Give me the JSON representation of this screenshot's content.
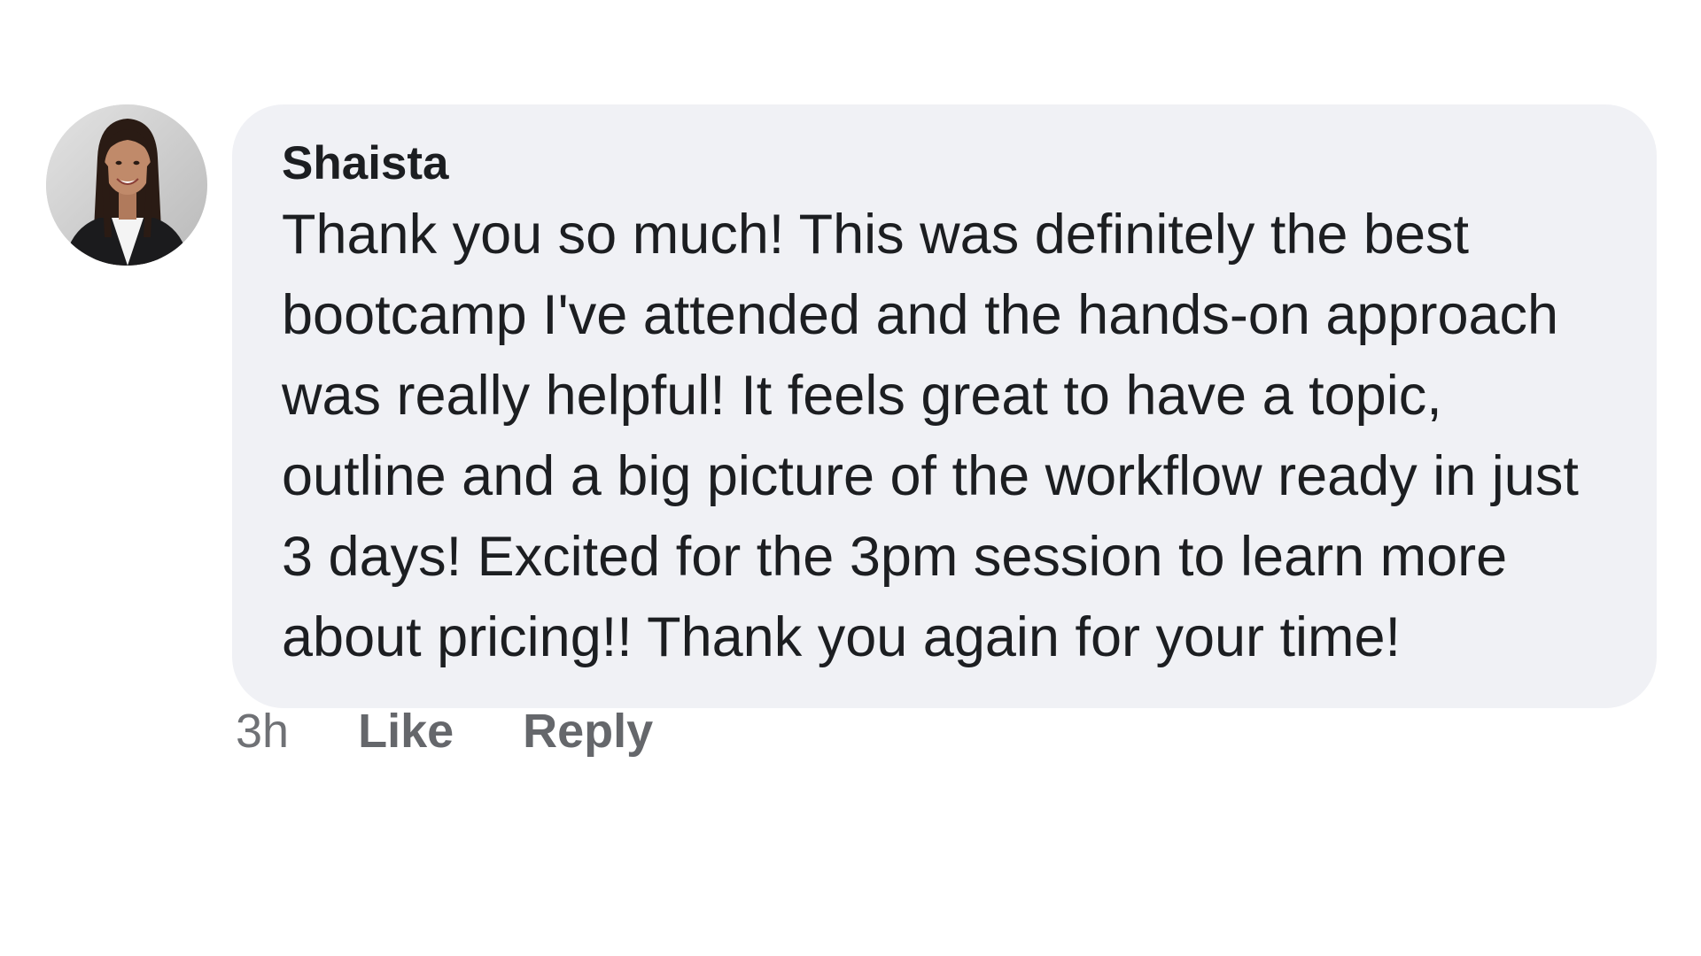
{
  "comment": {
    "author": "Shaista",
    "text": "Thank you so much! This was definitely the best bootcamp I've attended and the hands-on approach was really helpful! It feels great to have a topic, outline and a big picture of the workflow ready in just 3 days! Excited for the 3pm session to learn more about pricing!! Thank you again for your time!",
    "timestamp": "3h",
    "like_label": "Like",
    "reply_label": "Reply"
  },
  "colors": {
    "bubble_background": "#f0f1f5",
    "text": "#1c1e21",
    "meta_text": "#65676b"
  }
}
